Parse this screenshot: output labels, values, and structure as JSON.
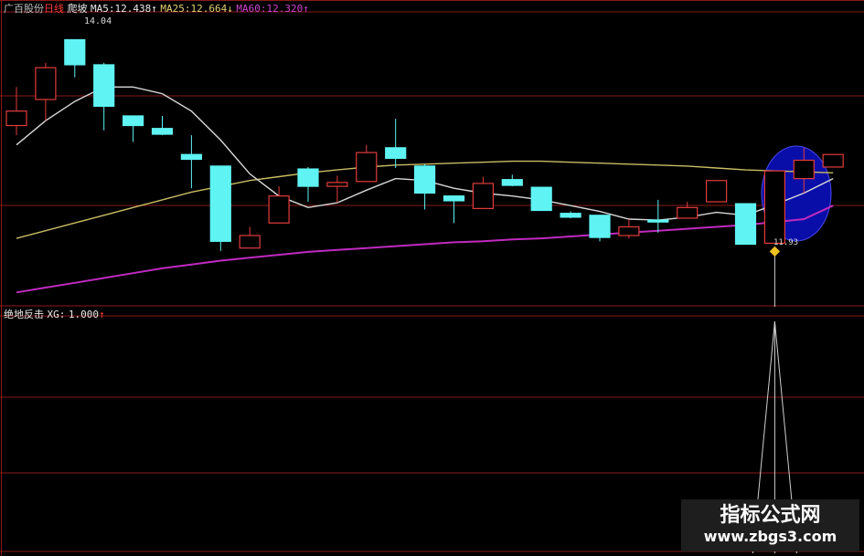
{
  "header": {
    "stock_name": "广百股份",
    "period": "日线",
    "indicator": "爬坡",
    "ma5_label": "MA5:",
    "ma5_value": "12.438",
    "ma5_arrow": "↑",
    "ma25_label": "MA25:",
    "ma25_value": "12.664",
    "ma25_arrow": "↓",
    "ma60_label": "MA60:",
    "ma60_value": "12.320",
    "ma60_arrow": "↑",
    "high_marker": "14.04",
    "low_marker": "11.93"
  },
  "sub_header": {
    "indicator_name": "绝地反击",
    "xg_label": "XG:",
    "xg_value": "1.000",
    "xg_arrow": "↑"
  },
  "watermark": {
    "line1": "指标公式网",
    "line2": "www.zbgs3.com"
  },
  "colors": {
    "up_candle": "#e23c3c",
    "down_candle": "#5ff3f3",
    "ma5": "#d8d8d8",
    "ma25": "#c9bc63",
    "ma60": "#c02ac0",
    "grid": "#8a1a1a",
    "highlight_ellipse": "#0a0ea8",
    "signal_line": "#d0d0d0"
  },
  "chart_data": [
    {
      "type": "candlestick",
      "title": "广百股份 日线",
      "ylim": [
        11.3,
        14.3
      ],
      "candles": [
        {
          "o": 13.15,
          "c": 13.3,
          "h": 13.55,
          "l": 13.05
        },
        {
          "o": 13.42,
          "c": 13.75,
          "h": 13.8,
          "l": 13.2
        },
        {
          "o": 14.04,
          "c": 13.78,
          "h": 14.04,
          "l": 13.65
        },
        {
          "o": 13.78,
          "c": 13.35,
          "h": 13.8,
          "l": 13.1
        },
        {
          "o": 13.25,
          "c": 13.15,
          "h": 13.25,
          "l": 12.98
        },
        {
          "o": 13.12,
          "c": 13.06,
          "h": 13.25,
          "l": 13.05
        },
        {
          "o": 12.85,
          "c": 12.8,
          "h": 13.05,
          "l": 12.5
        },
        {
          "o": 12.73,
          "c": 11.95,
          "h": 12.73,
          "l": 11.85
        },
        {
          "o": 11.88,
          "c": 12.01,
          "h": 12.1,
          "l": 11.88
        },
        {
          "o": 12.14,
          "c": 12.42,
          "h": 12.52,
          "l": 12.14
        },
        {
          "o": 12.7,
          "c": 12.52,
          "h": 12.72,
          "l": 12.36
        },
        {
          "o": 12.52,
          "c": 12.56,
          "h": 12.63,
          "l": 12.35
        },
        {
          "o": 12.57,
          "c": 12.87,
          "h": 12.95,
          "l": 12.57
        },
        {
          "o": 12.92,
          "c": 12.81,
          "h": 13.22,
          "l": 12.71
        },
        {
          "o": 12.73,
          "c": 12.45,
          "h": 12.75,
          "l": 12.28
        },
        {
          "o": 12.42,
          "c": 12.37,
          "h": 12.42,
          "l": 12.14
        },
        {
          "o": 12.29,
          "c": 12.55,
          "h": 12.62,
          "l": 12.29
        },
        {
          "o": 12.59,
          "c": 12.53,
          "h": 12.64,
          "l": 12.52
        },
        {
          "o": 12.51,
          "c": 12.27,
          "h": 12.51,
          "l": 12.27
        },
        {
          "o": 12.24,
          "c": 12.2,
          "h": 12.26,
          "l": 12.19
        },
        {
          "o": 12.22,
          "c": 11.99,
          "h": 12.22,
          "l": 11.95
        },
        {
          "o": 12.01,
          "c": 12.1,
          "h": 12.18,
          "l": 11.98
        },
        {
          "o": 12.17,
          "c": 12.15,
          "h": 12.38,
          "l": 12.04
        },
        {
          "o": 12.19,
          "c": 12.3,
          "h": 12.36,
          "l": 12.19
        },
        {
          "o": 12.36,
          "c": 12.58,
          "h": 12.58,
          "l": 12.36
        },
        {
          "o": 12.34,
          "c": 11.92,
          "h": 12.34,
          "l": 11.92
        },
        {
          "o": 11.93,
          "c": 12.68,
          "h": 12.68,
          "l": 11.93
        },
        {
          "o": 12.6,
          "c": 12.79,
          "h": 12.92,
          "l": 12.45
        },
        {
          "o": 12.72,
          "c": 12.85,
          "h": 12.85,
          "l": 12.72
        }
      ],
      "ma5": [
        12.95,
        13.2,
        13.4,
        13.55,
        13.55,
        13.48,
        13.3,
        13.0,
        12.65,
        12.42,
        12.3,
        12.35,
        12.48,
        12.6,
        12.58,
        12.5,
        12.45,
        12.42,
        12.38,
        12.32,
        12.26,
        12.18,
        12.17,
        12.2,
        12.25,
        12.22,
        12.33,
        12.45,
        12.6
      ],
      "ma25": [
        11.98,
        12.06,
        12.14,
        12.22,
        12.3,
        12.38,
        12.46,
        12.52,
        12.58,
        12.62,
        12.66,
        12.69,
        12.72,
        12.74,
        12.75,
        12.76,
        12.77,
        12.78,
        12.78,
        12.77,
        12.76,
        12.75,
        12.74,
        12.73,
        12.71,
        12.69,
        12.68,
        12.67,
        12.66
      ],
      "ma60": [
        11.42,
        11.47,
        11.52,
        11.57,
        11.62,
        11.67,
        11.71,
        11.75,
        11.78,
        11.81,
        11.84,
        11.86,
        11.88,
        11.9,
        11.92,
        11.94,
        11.95,
        11.97,
        11.98,
        12.0,
        12.02,
        12.04,
        12.06,
        12.08,
        12.1,
        12.12,
        12.15,
        12.18,
        12.32
      ]
    },
    {
      "type": "line",
      "title": "绝地反击",
      "series": [
        {
          "name": "XG",
          "values": [
            0,
            0,
            0,
            0,
            0,
            0,
            0,
            0,
            0,
            0,
            0,
            0,
            0,
            0,
            0,
            0,
            0,
            0,
            0,
            0,
            0,
            0,
            0,
            0,
            0,
            0,
            1,
            0,
            0
          ]
        }
      ],
      "ylim": [
        0,
        1
      ]
    }
  ]
}
